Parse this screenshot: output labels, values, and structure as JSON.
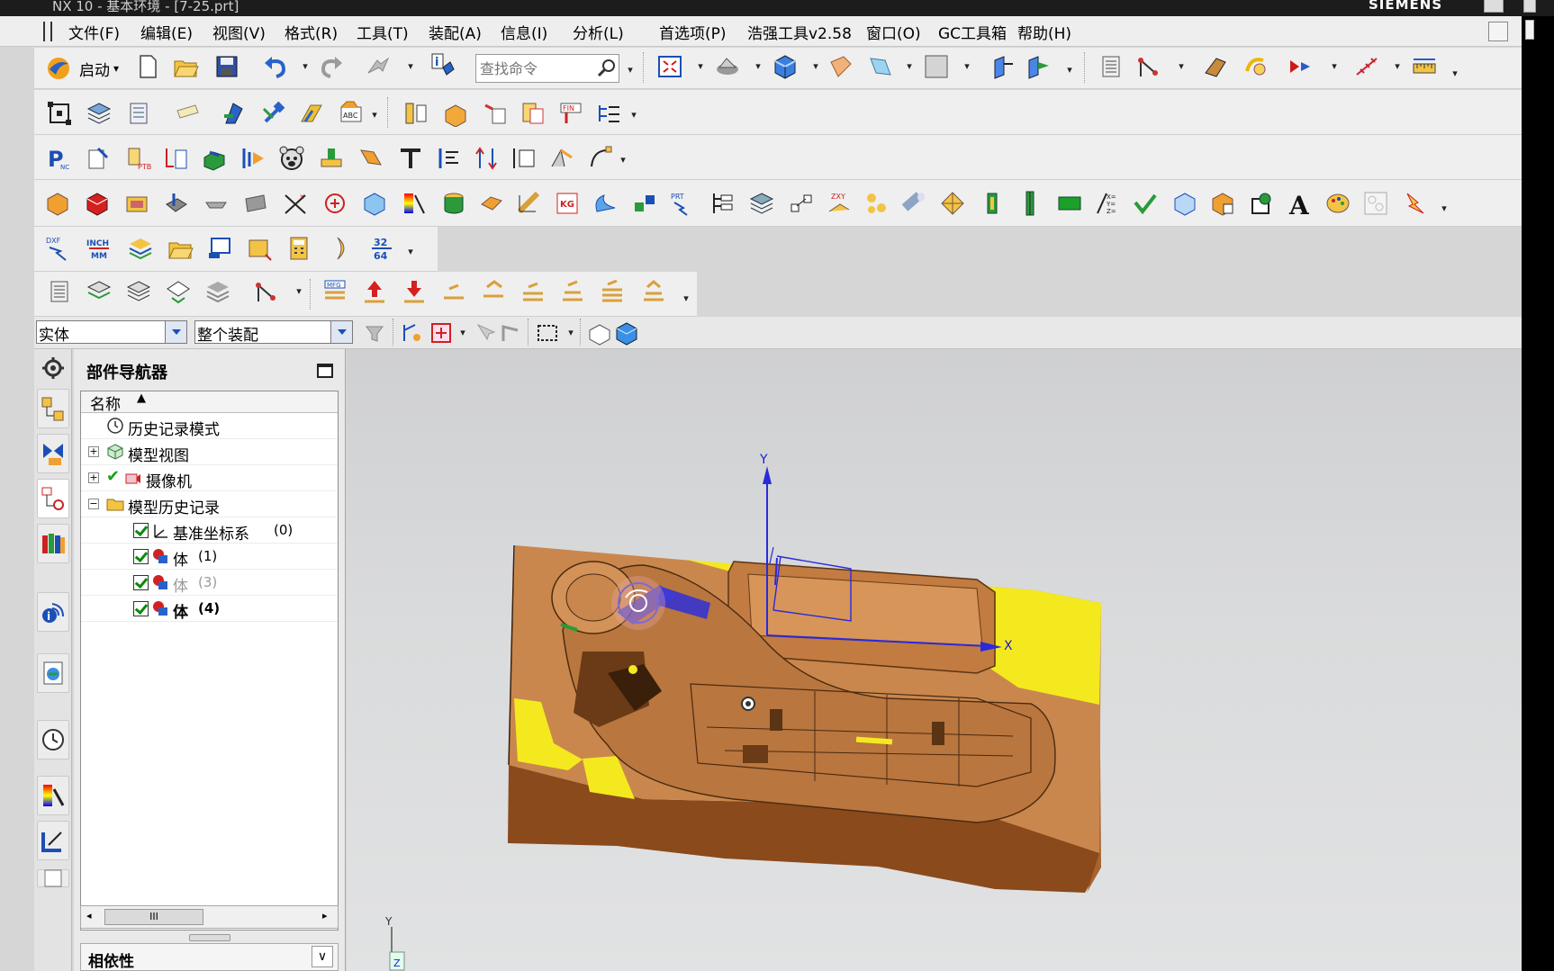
{
  "window": {
    "title": "NX 10 - 基本环境 - [7-25.prt]",
    "brand": "SIEMENS"
  },
  "menu": {
    "items": [
      "文件(F)",
      "编辑(E)",
      "视图(V)",
      "格式(R)",
      "工具(T)",
      "装配(A)",
      "信息(I)",
      "分析(L)",
      "首选项(P)",
      "浩强工具v2.58",
      "窗口(O)",
      "GC工具箱",
      "帮助(H)"
    ]
  },
  "toolbar": {
    "start_label": "启动",
    "search_placeholder": "查找命令"
  },
  "selection": {
    "filter_type": "实体",
    "filter_scope": "整个装配"
  },
  "navigator": {
    "title": "部件导航器",
    "column_name": "名称",
    "nodes": [
      {
        "label": "历史记录模式",
        "count": ""
      },
      {
        "label": "模型视图",
        "count": ""
      },
      {
        "label": "摄像机",
        "count": ""
      },
      {
        "label": "模型历史记录",
        "count": ""
      },
      {
        "label": "基准坐标系",
        "count": "(0)"
      },
      {
        "label": "体",
        "count": "(1)"
      },
      {
        "label": "体",
        "count": "(3)"
      },
      {
        "label": "体",
        "count": "(4)"
      }
    ],
    "dependency_title": "相依性",
    "scroll_thumb": "III"
  },
  "viewport": {
    "axis_x": "X",
    "axis_y": "Y",
    "axis_z": "Z"
  },
  "colors": {
    "model_copper": "#c9874d",
    "model_face_yellow": "#f4e91f",
    "wcs_blue": "#2a2ad8",
    "toolbar_bg": "#efefef"
  },
  "icons": [
    "start-icon",
    "new-icon",
    "open-icon",
    "save-icon",
    "undo-icon",
    "redo-icon",
    "info-icon",
    "fit-icon",
    "shade-icon",
    "cube-icon",
    "layer-icon",
    "view-icon",
    "measure-icon",
    "text-A-icon",
    "moon-icon",
    "calculator-icon"
  ]
}
